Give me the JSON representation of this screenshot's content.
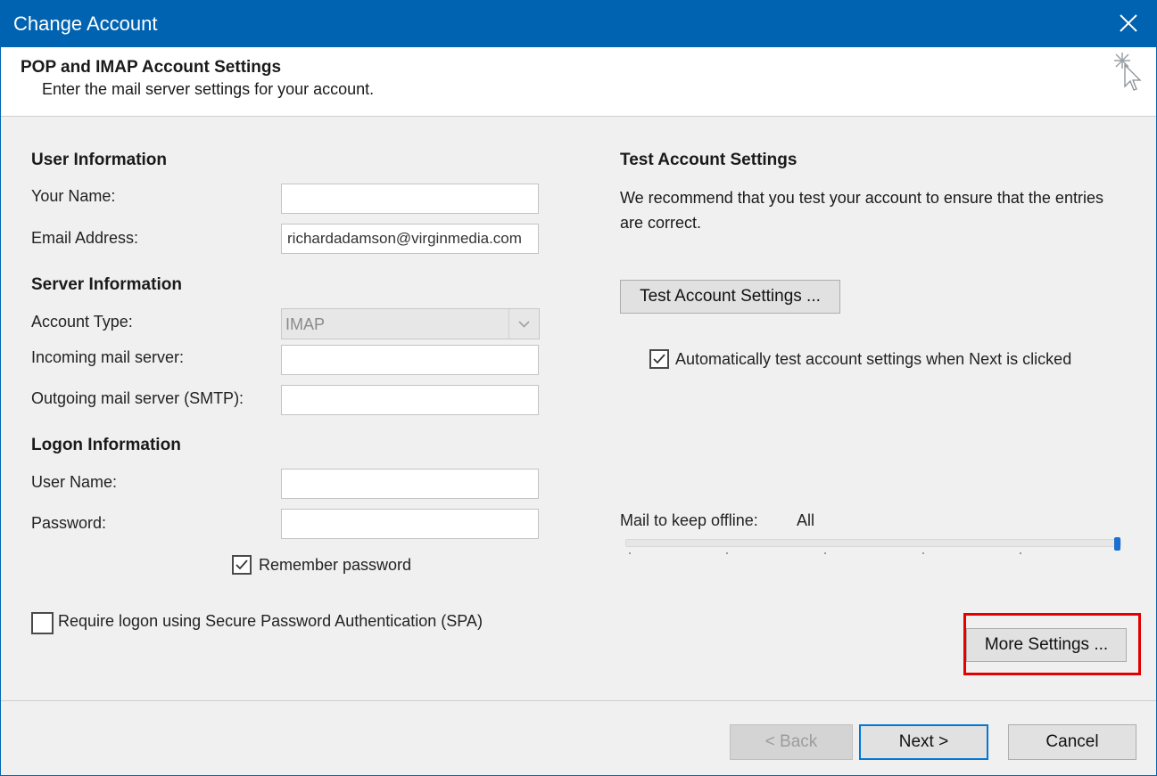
{
  "window": {
    "title": "Change Account"
  },
  "header": {
    "title": "POP and IMAP Account Settings",
    "subtitle": "Enter the mail server settings for your account."
  },
  "user_info": {
    "heading": "User Information",
    "name_label": "Your Name:",
    "name_value": "",
    "email_label": "Email Address:",
    "email_value": "richardadamson@virginmedia.com"
  },
  "server_info": {
    "heading": "Server Information",
    "account_type_label": "Account Type:",
    "account_type_value": "IMAP",
    "incoming_label": "Incoming mail server:",
    "incoming_value": "",
    "outgoing_label": "Outgoing mail server (SMTP):",
    "outgoing_value": ""
  },
  "logon_info": {
    "heading": "Logon Information",
    "username_label": "User Name:",
    "username_value": "",
    "password_label": "Password:",
    "password_value": "",
    "remember_password_label": "Remember password",
    "remember_password_checked": true,
    "spa_label": "Require logon using Secure Password Authentication (SPA)",
    "spa_checked": false
  },
  "test_settings": {
    "heading": "Test Account Settings",
    "description": "We recommend that you test your account to ensure that the entries are correct.",
    "button_label": "Test Account Settings ...",
    "auto_test_label": "Automatically test account settings when Next is clicked",
    "auto_test_checked": true
  },
  "offline": {
    "label": "Mail to keep offline:",
    "value": "All",
    "level_fraction": 1.0
  },
  "buttons": {
    "more_settings": "More Settings ...",
    "back": "< Back",
    "next": "Next >",
    "cancel": "Cancel"
  },
  "colors": {
    "titlebar": "#0063b1",
    "highlight": "#e30000",
    "slider": "#1a6fd0"
  },
  "icons": {
    "close": "close-icon",
    "wizard": "cursor-sparkle-icon",
    "dropdown": "chevron-down-icon",
    "check": "checkmark-icon"
  }
}
